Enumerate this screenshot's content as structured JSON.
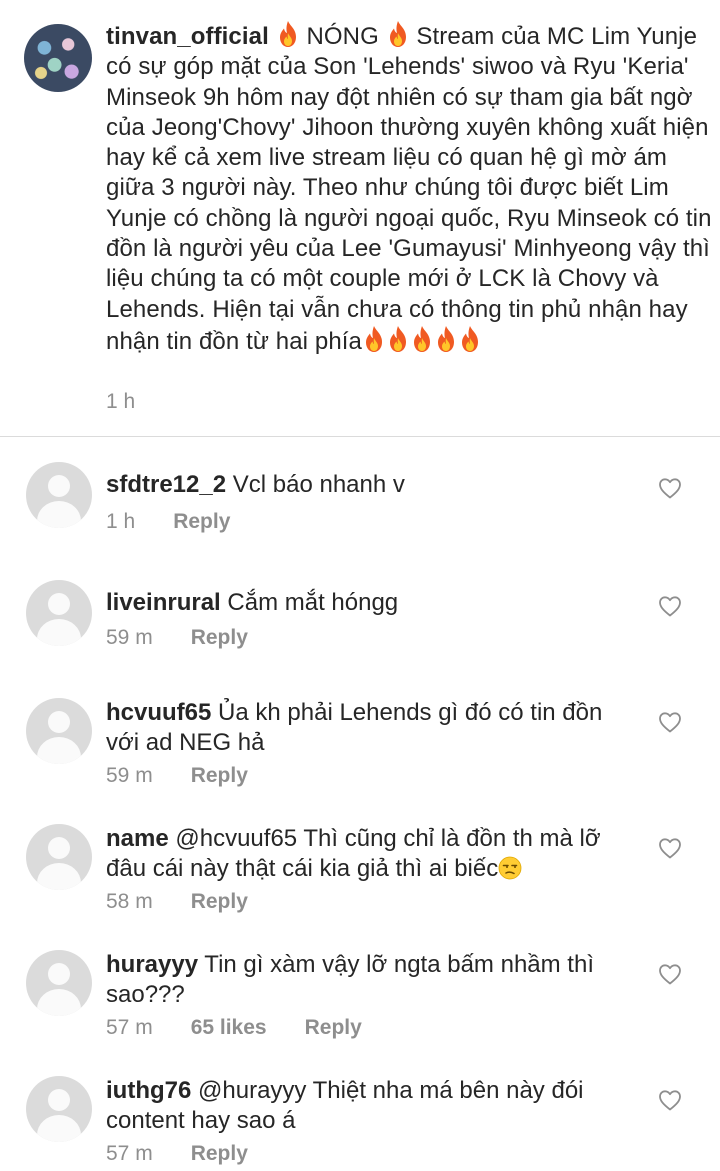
{
  "post": {
    "username": "tinvan_official",
    "fire_emoji": "🔥",
    "lead": "NÓNG",
    "caption": "Stream của MC Lim Yunje có sự góp mặt của Son 'Lehends' siwoo và Ryu 'Keria' Minseok 9h hôm nay đột nhiên có sự tham gia bất ngờ của Jeong'Chovy' Jihoon thường xuyên không xuất hiện hay kể cả xem live stream liệu có quan hệ gì mờ ám giữa 3 người này. Theo như chúng tôi được biết Lim Yunje có chồng là người ngoại quốc, Ryu Minseok có tin đồn là người yêu của Lee 'Gumayusi' Minhyeong vậy thì liệu chúng ta có một couple mới ở LCK là Chovy và Lehends. Hiện tại vẫn chưa có thông tin phủ nhận hay nhận tin đồn từ hai phía",
    "time": "1 h"
  },
  "comments": [
    {
      "username": "sfdtre12_2",
      "text": "Vcl báo nhanh v",
      "time": "1 h",
      "likes": "",
      "reply_label": "Reply"
    },
    {
      "username": "liveinrural",
      "text": "Cắm mắt hóngg",
      "time": "59 m",
      "likes": "",
      "reply_label": "Reply"
    },
    {
      "username": "hcvuuf65",
      "text": "Ủa kh phải Lehends gì đó có tin đồn với ad NEG hả",
      "time": "59 m",
      "likes": "",
      "reply_label": "Reply"
    },
    {
      "username": "name",
      "text": "@hcvuuf65 Thì cũng chỉ là đồn th mà lỡ đâu cái này thật cái kia giả thì ai biếc",
      "emoji": "😒",
      "time": "58 m",
      "likes": "",
      "reply_label": "Reply"
    },
    {
      "username": "hurayyy",
      "text": "Tin gì xàm vậy lỡ ngta bấm nhầm thì sao???",
      "time": "57 m",
      "likes": "65 likes",
      "reply_label": "Reply"
    },
    {
      "username": "iuthg76",
      "text": "@hurayyy Thiệt nha má bên này đói content hay sao á",
      "time": "57 m",
      "likes": "",
      "reply_label": "Reply"
    }
  ],
  "icons": {
    "like": "heart-outline-icon",
    "avatar_placeholder": "default-avatar-icon"
  },
  "colors": {
    "text": "#262626",
    "meta": "#8e8e8e",
    "divider": "#dbdbdb",
    "avatar_placeholder": "#dbdbdb",
    "fire": "#f05a22"
  }
}
